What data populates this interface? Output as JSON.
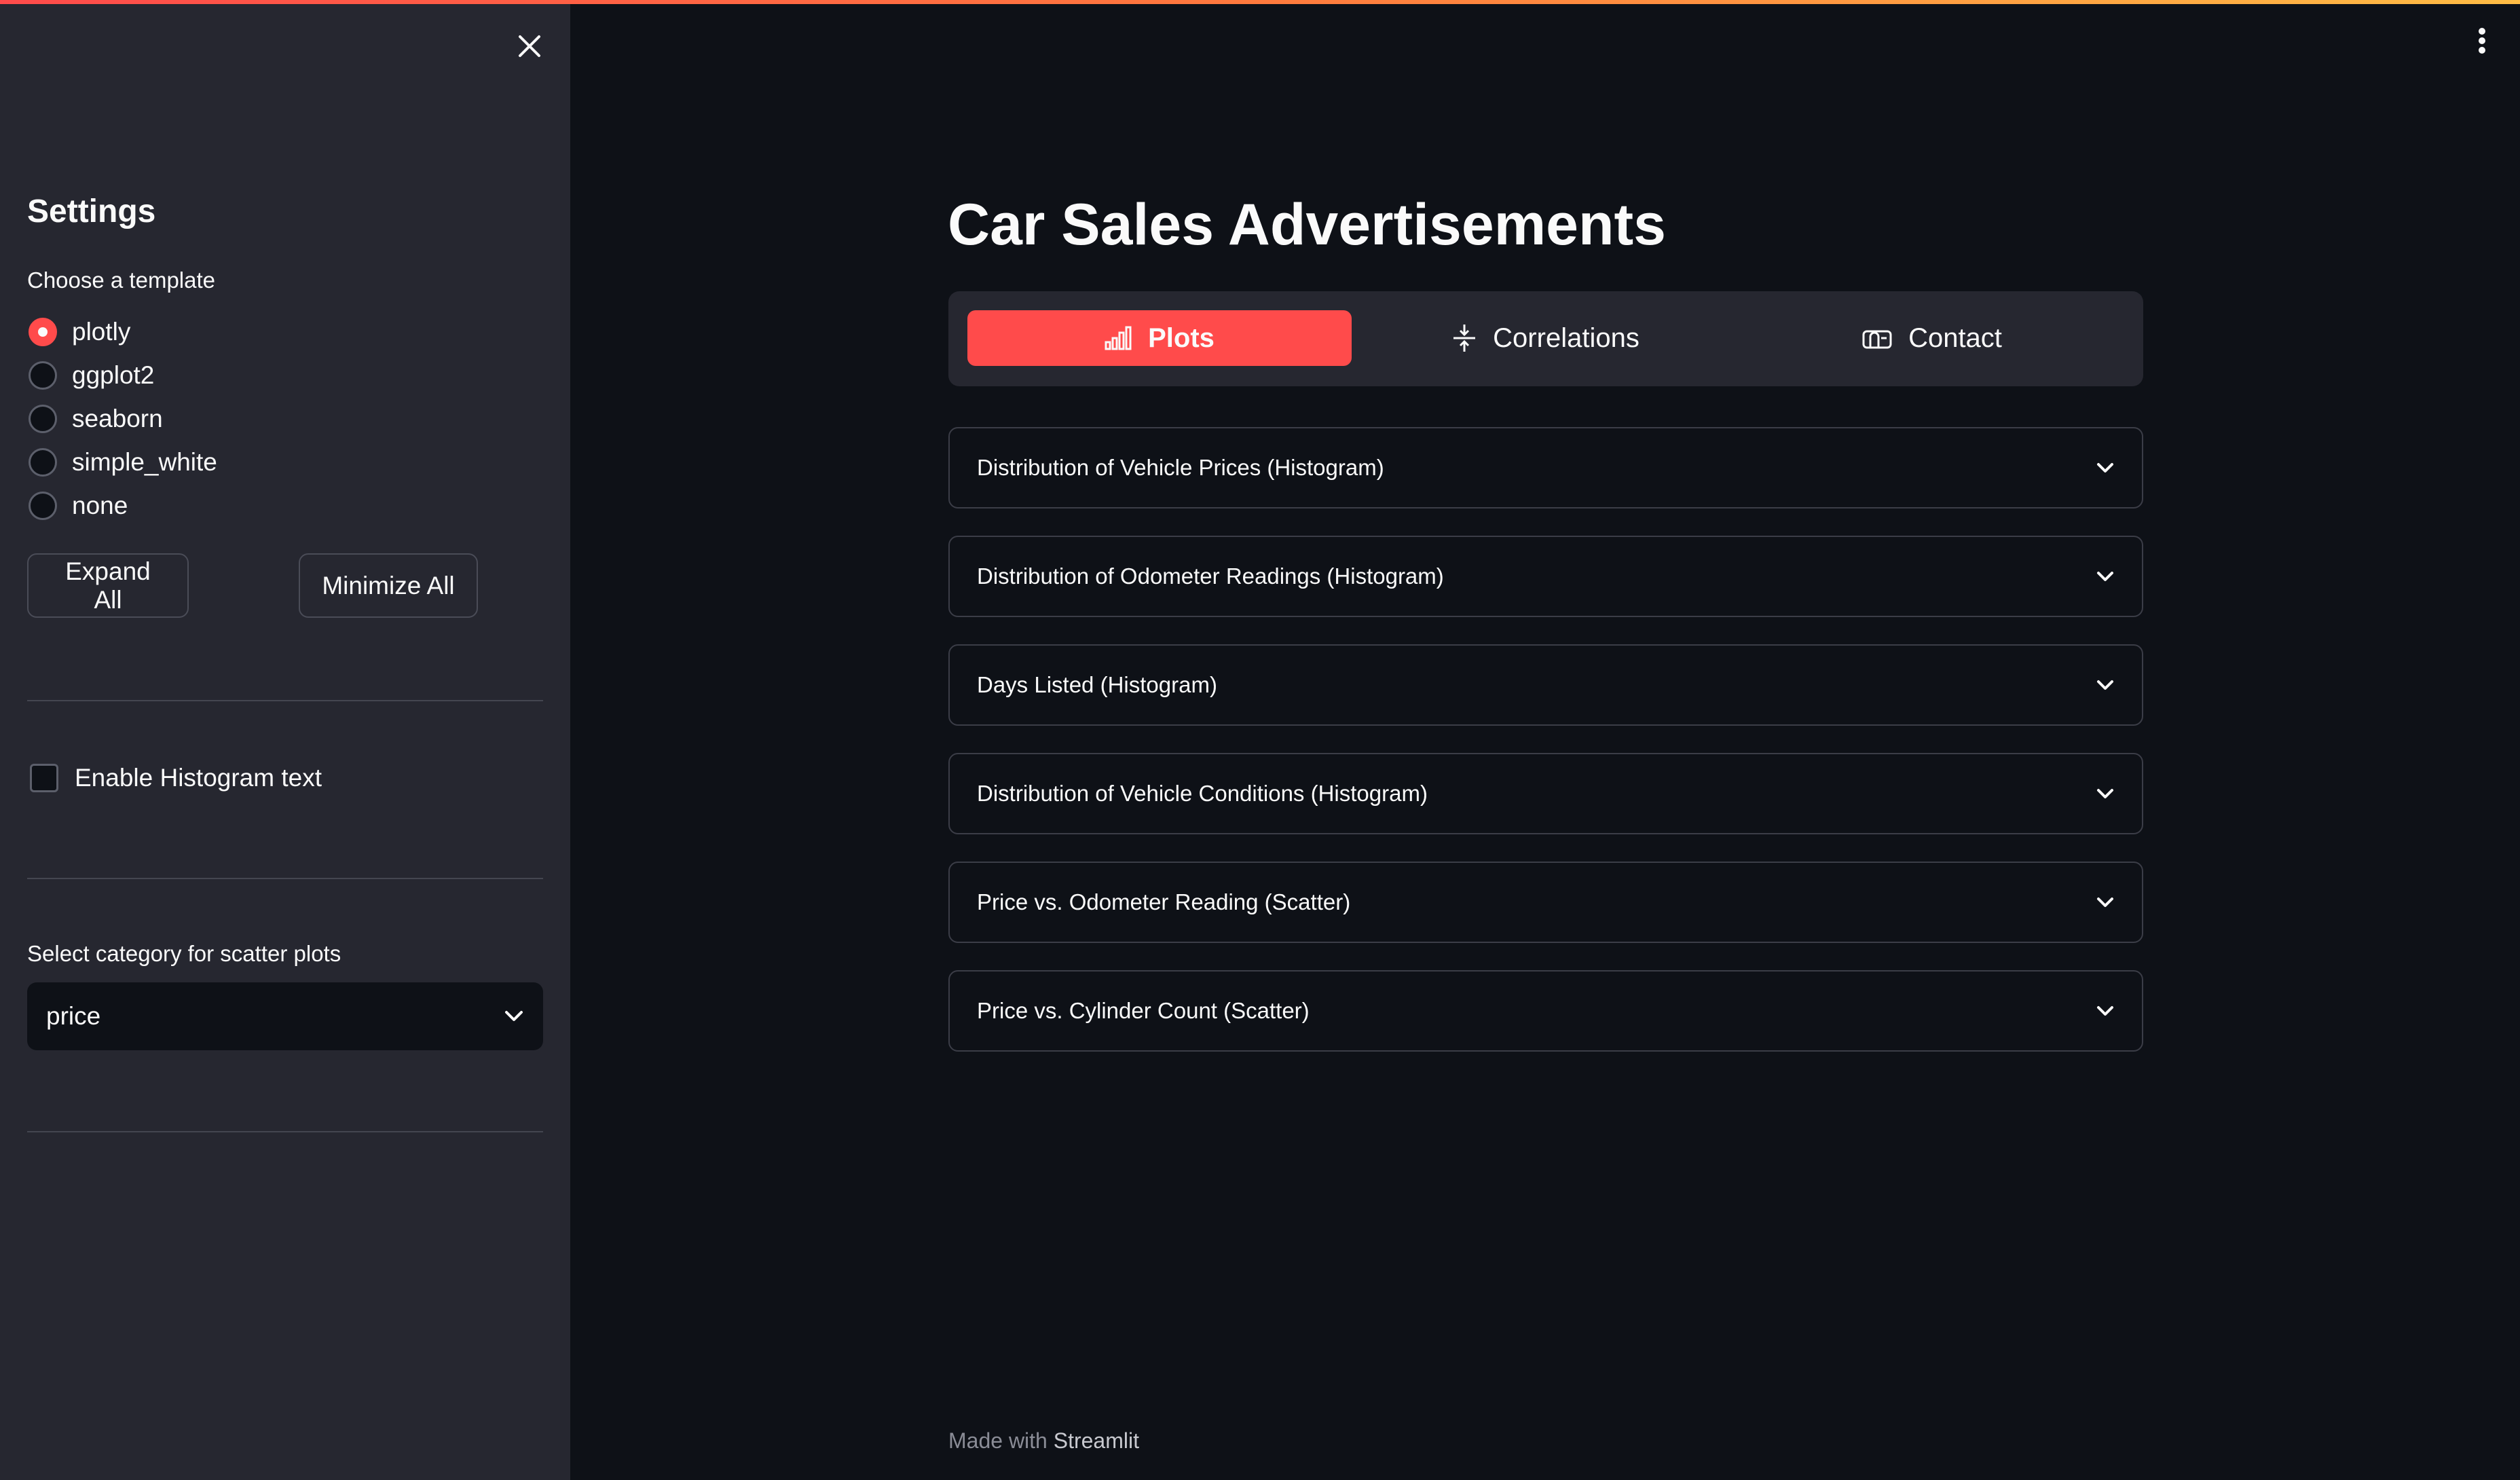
{
  "sidebar": {
    "title": "Settings",
    "template_label": "Choose a template",
    "templates": [
      {
        "label": "plotly",
        "checked": true
      },
      {
        "label": "ggplot2",
        "checked": false
      },
      {
        "label": "seaborn",
        "checked": false
      },
      {
        "label": "simple_white",
        "checked": false
      },
      {
        "label": "none",
        "checked": false
      }
    ],
    "expand_all": "Expand All",
    "minimize_all": "Minimize All",
    "histogram_text_label": "Enable Histogram text",
    "histogram_text_checked": false,
    "scatter_category_label": "Select category for scatter plots",
    "scatter_category_value": "price"
  },
  "main": {
    "title": "Car Sales Advertisements",
    "tabs": [
      {
        "label": "Plots",
        "icon": "bar-chart-icon",
        "active": true
      },
      {
        "label": "Correlations",
        "icon": "compress-arrows-icon",
        "active": false
      },
      {
        "label": "Contact",
        "icon": "mailbox-icon",
        "active": false
      }
    ],
    "expanders": [
      "Distribution of Vehicle Prices (Histogram)",
      "Distribution of Odometer Readings (Histogram)",
      "Days Listed (Histogram)",
      "Distribution of Vehicle Conditions (Histogram)",
      "Price vs. Odometer Reading (Scatter)",
      "Price vs. Cylinder Count (Scatter)"
    ]
  },
  "footer": {
    "prefix": "Made with",
    "brand": "Streamlit"
  },
  "colors": {
    "accent": "#ff4b4b",
    "background": "#0e1117",
    "sidebar": "#262730"
  }
}
